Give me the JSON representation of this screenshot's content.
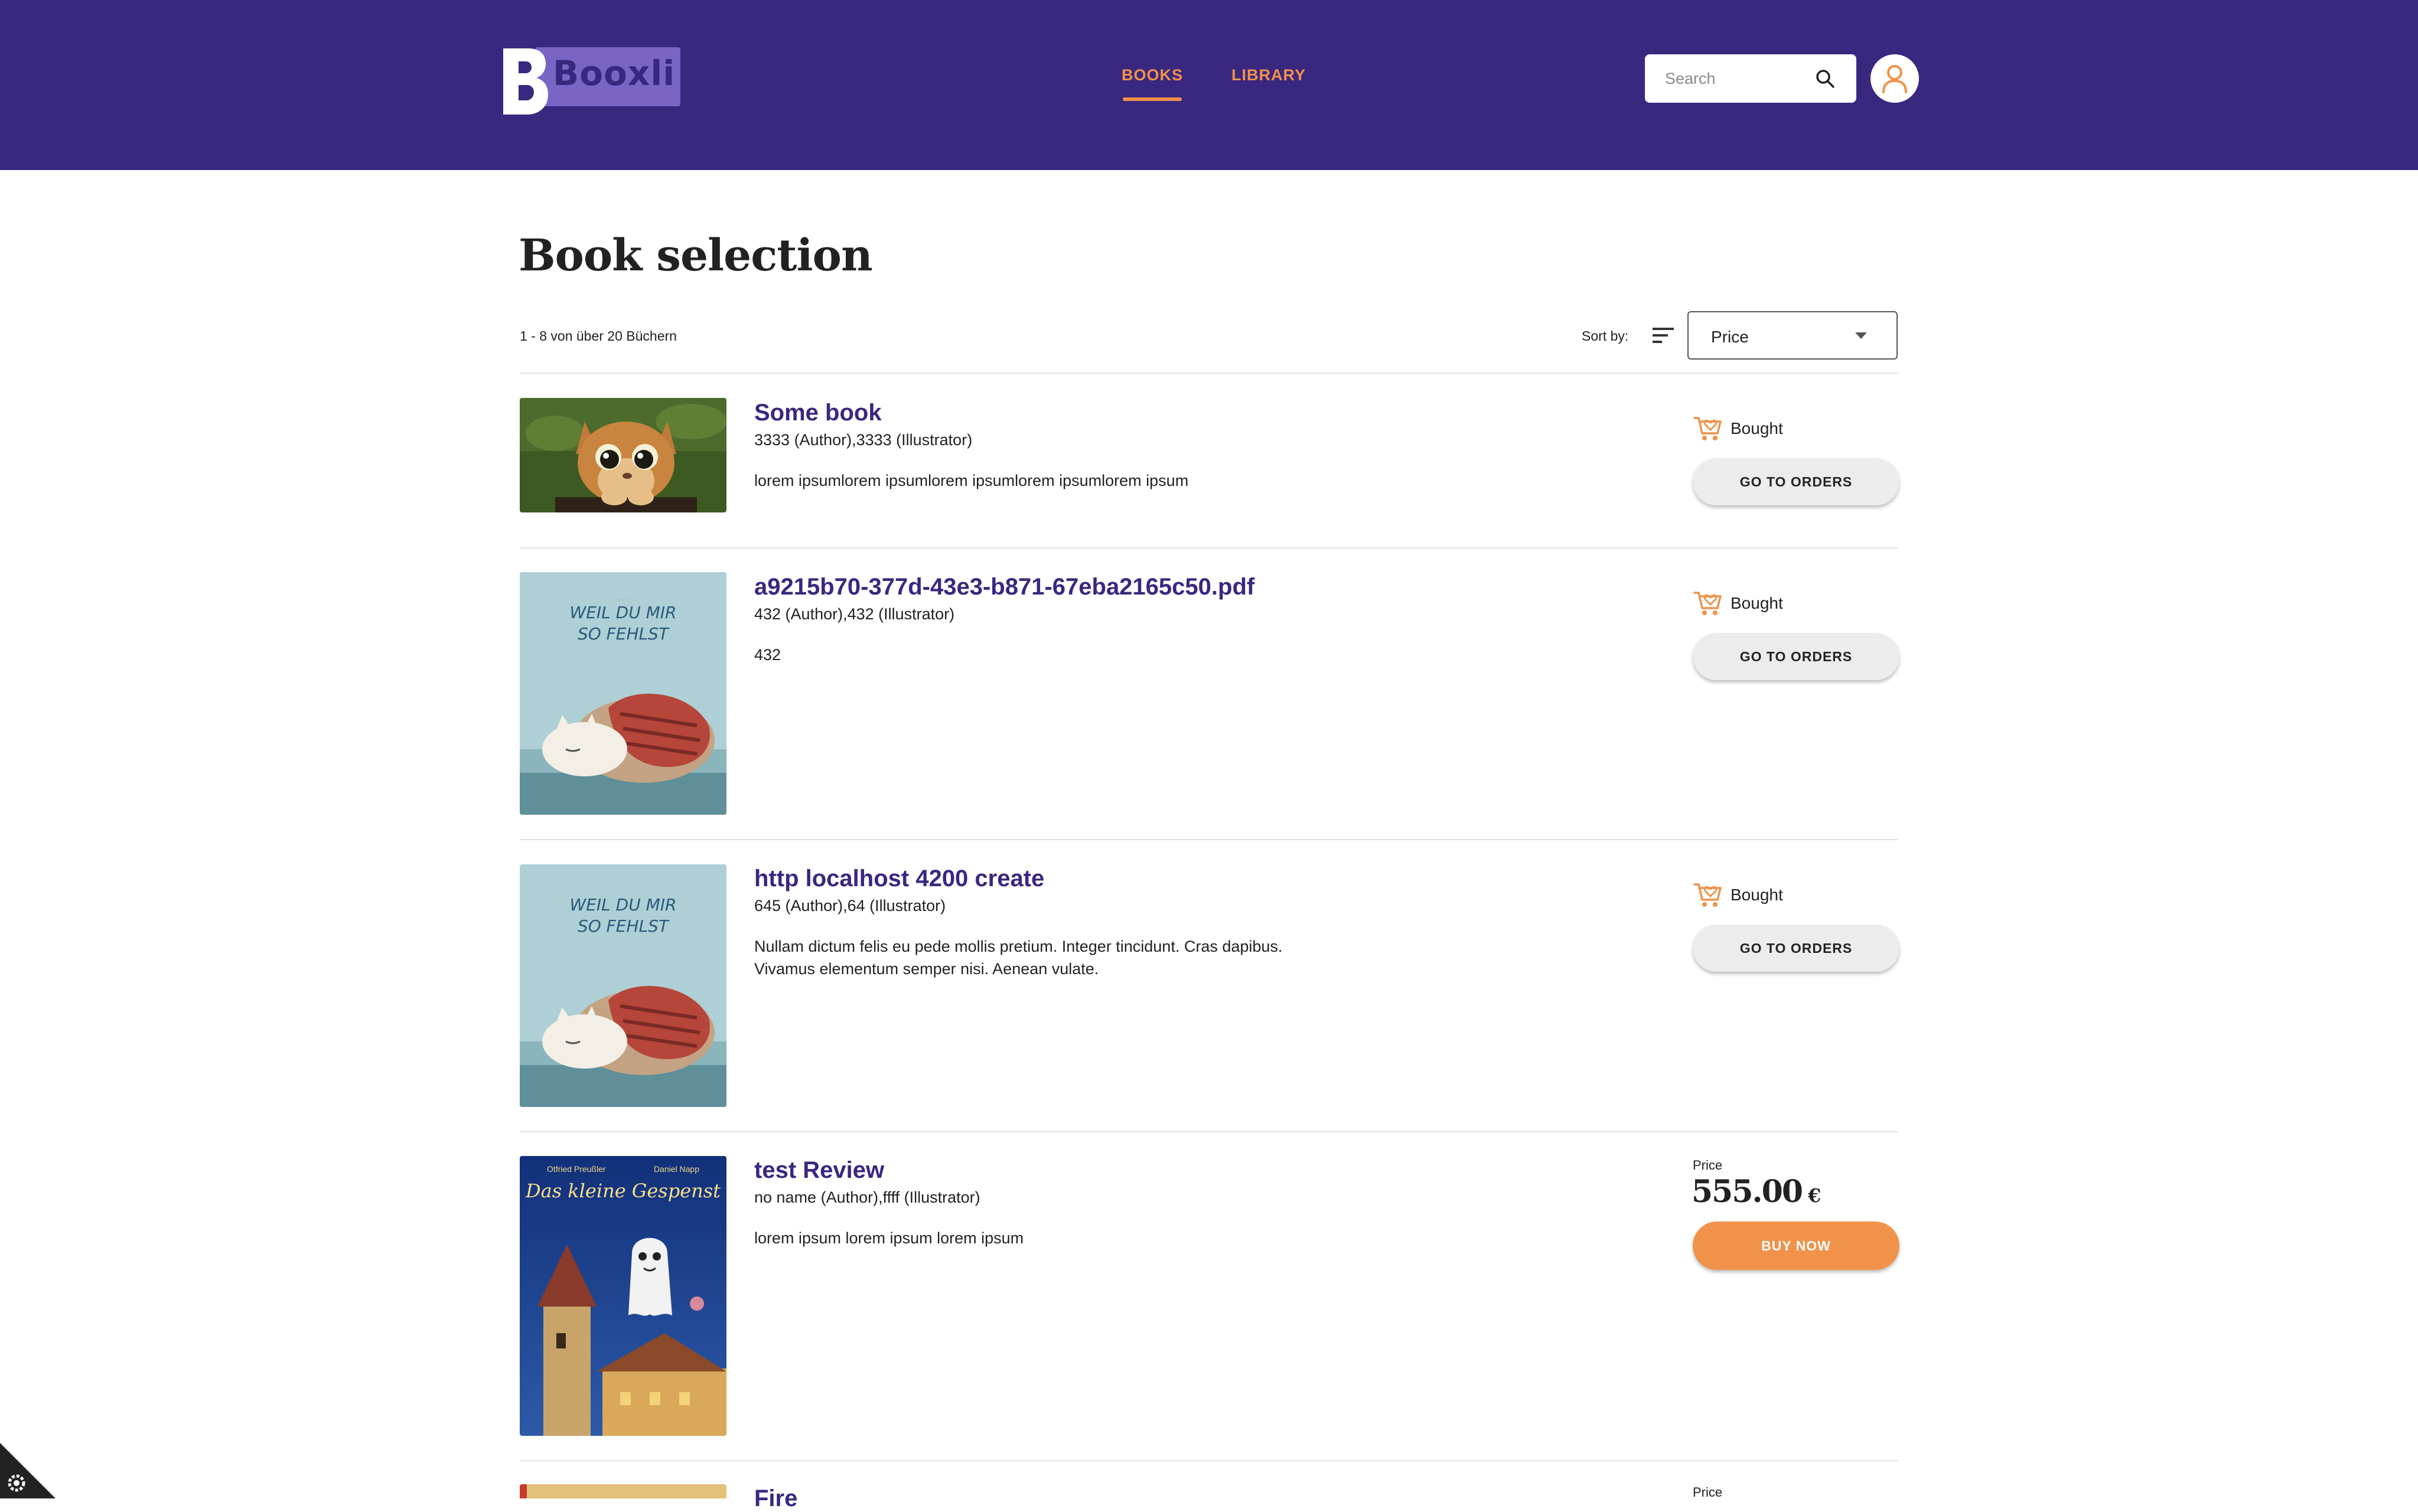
{
  "header": {
    "logo_text": "Booxli",
    "nav": [
      {
        "label": "BOOKS",
        "active": true
      },
      {
        "label": "LIBRARY",
        "active": false
      }
    ],
    "search": {
      "placeholder": "Search"
    },
    "colors": {
      "header_bg": "#3a2780",
      "accent": "#f0924a"
    }
  },
  "main": {
    "title": "Book selection",
    "count_text": "1 - 8 von über 20 Büchern",
    "sort": {
      "label": "Sort by:",
      "value": "Price"
    },
    "books": [
      {
        "title": "Some book",
        "meta": "3333 (Author),3333 (Illustrator)",
        "description": "lorem ipsumlorem ipsumlorem ipsumlorem ipsumlorem ipsum",
        "status": "Bought",
        "action": "GO TO ORDERS"
      },
      {
        "title": "a9215b70-377d-43e3-b871-67eba2165c50.pdf",
        "meta": "432 (Author),432 (Illustrator)",
        "description": "432",
        "status": "Bought",
        "action": "GO TO ORDERS",
        "cover_text": [
          "WEIL DU MIR",
          "SO FEHLST"
        ]
      },
      {
        "title": "http localhost 4200 create",
        "meta": "645 (Author),64 (Illustrator)",
        "description": "Nullam dictum felis eu pede mollis pretium. Integer tincidunt. Cras dapibus. Vivamus elementum semper nisi. Aenean vulate.",
        "status": "Bought",
        "action": "GO TO ORDERS",
        "cover_text": [
          "WEIL DU MIR",
          "SO FEHLST"
        ]
      },
      {
        "title": "test Review",
        "meta": "no name (Author),ffff (Illustrator)",
        "description": "lorem ipsum lorem ipsum lorem ipsum",
        "price_label": "Price",
        "price": "555.00",
        "currency": "€",
        "action": "BUY NOW",
        "cover_text": [
          "Otfried Preußler",
          "Daniel Napp",
          "Das kleine Gespenst"
        ]
      },
      {
        "title": "Fire",
        "price_label": "Price"
      }
    ]
  }
}
